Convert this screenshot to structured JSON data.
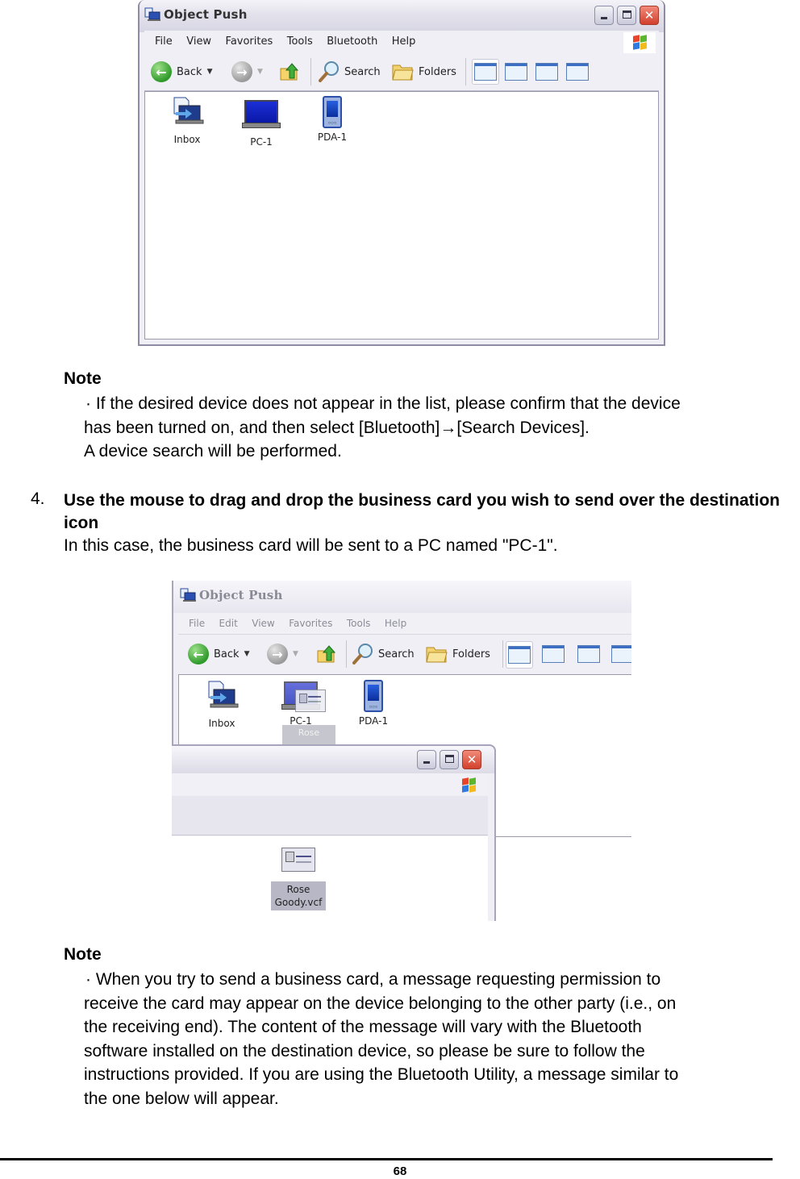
{
  "screenshot1": {
    "title": "Object Push",
    "menu": [
      "File",
      "View",
      "Favorites",
      "Tools",
      "Bluetooth",
      "Help"
    ],
    "toolbar": {
      "back": "Back",
      "search": "Search",
      "folders": "Folders"
    },
    "items": [
      "Inbox",
      "PC-1",
      "PDA-1"
    ]
  },
  "note1": {
    "heading": "Note",
    "lines": [
      "· If the desired device does not appear in the list, please confirm that the device",
      "has been turned on, and then select [Bluetooth]→[Search Devices].",
      "A device search will be performed."
    ]
  },
  "step4": {
    "number": "4.",
    "title": "Use the mouse to drag and drop the business card you wish to send over the destination icon",
    "description": "In this case, the business card will be sent to a PC named \"PC-1\"."
  },
  "screenshot2": {
    "title": "Object Push",
    "menu": [
      "File",
      "Edit",
      "View",
      "Favorites",
      "Tools",
      "Help"
    ],
    "toolbar": {
      "back": "Back",
      "search": "Search",
      "folders": "Folders"
    },
    "items": [
      "Inbox",
      "PC-1",
      "PDA-1"
    ],
    "drag_ghost_label": "Rose",
    "file_label_line1": "Rose",
    "file_label_line2": "Goody.vcf"
  },
  "note2": {
    "heading": "Note",
    "lines": [
      "· When you try to send a business card, a message requesting permission to",
      "receive the card may appear on the device belonging to the other party (i.e., on",
      "the receiving end). The content of the message will vary with the Bluetooth",
      "software installed on the destination device, so please be sure to follow the",
      "instructions provided. If you are using the Bluetooth Utility, a message similar to",
      "the one below will appear."
    ]
  },
  "footer": {
    "page_number": "68"
  }
}
